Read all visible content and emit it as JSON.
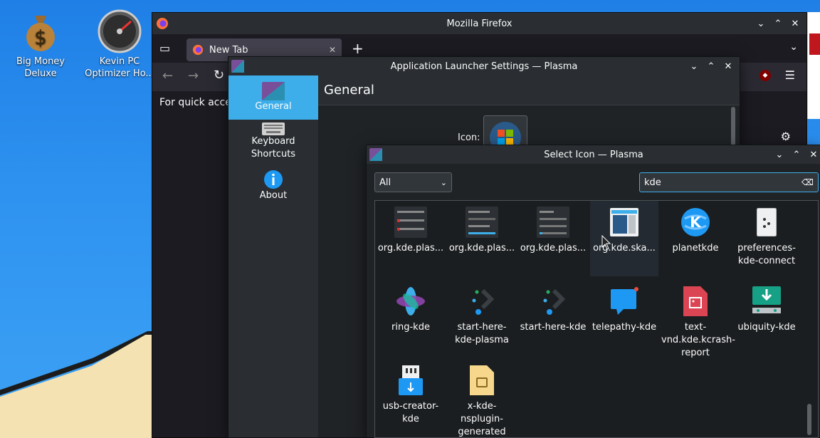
{
  "desktop": {
    "icons": [
      {
        "label": "Big Money Deluxe",
        "icon": "money-bag-icon"
      },
      {
        "label": "Kevin PC Optimizer Ho...",
        "icon": "gauge-icon"
      }
    ]
  },
  "firefox": {
    "title": "Mozilla Firefox",
    "tab_label": "New Tab",
    "content_text": "For quick acce"
  },
  "launcher": {
    "title": "Application Launcher Settings — Plasma",
    "header": "General",
    "icon_label": "Icon:",
    "nav": [
      {
        "label": "General"
      },
      {
        "label": "Keyboard Shortcuts"
      },
      {
        "label": "About"
      }
    ]
  },
  "select_icon": {
    "title": "Select Icon — Plasma",
    "category": "All",
    "search_value": "kde",
    "icons": [
      {
        "label": "org.kde.plas..."
      },
      {
        "label": "org.kde.plas..."
      },
      {
        "label": "org.kde.plas..."
      },
      {
        "label": "org.kde.ska..."
      },
      {
        "label": "planetkde"
      },
      {
        "label": "preferences-kde-connect"
      },
      {
        "label": "ring-kde"
      },
      {
        "label": "start-here-kde-plasma"
      },
      {
        "label": "start-here-kde"
      },
      {
        "label": "telepathy-kde"
      },
      {
        "label": "text-vnd.kde.kcrash-report"
      },
      {
        "label": "ubiquity-kde"
      },
      {
        "label": "usb-creator-kde"
      },
      {
        "label": "x-kde-nsplugin-generated"
      }
    ]
  },
  "colors": {
    "accent": "#3daee9",
    "window": "#202326",
    "titlebar": "#2a2e32"
  }
}
